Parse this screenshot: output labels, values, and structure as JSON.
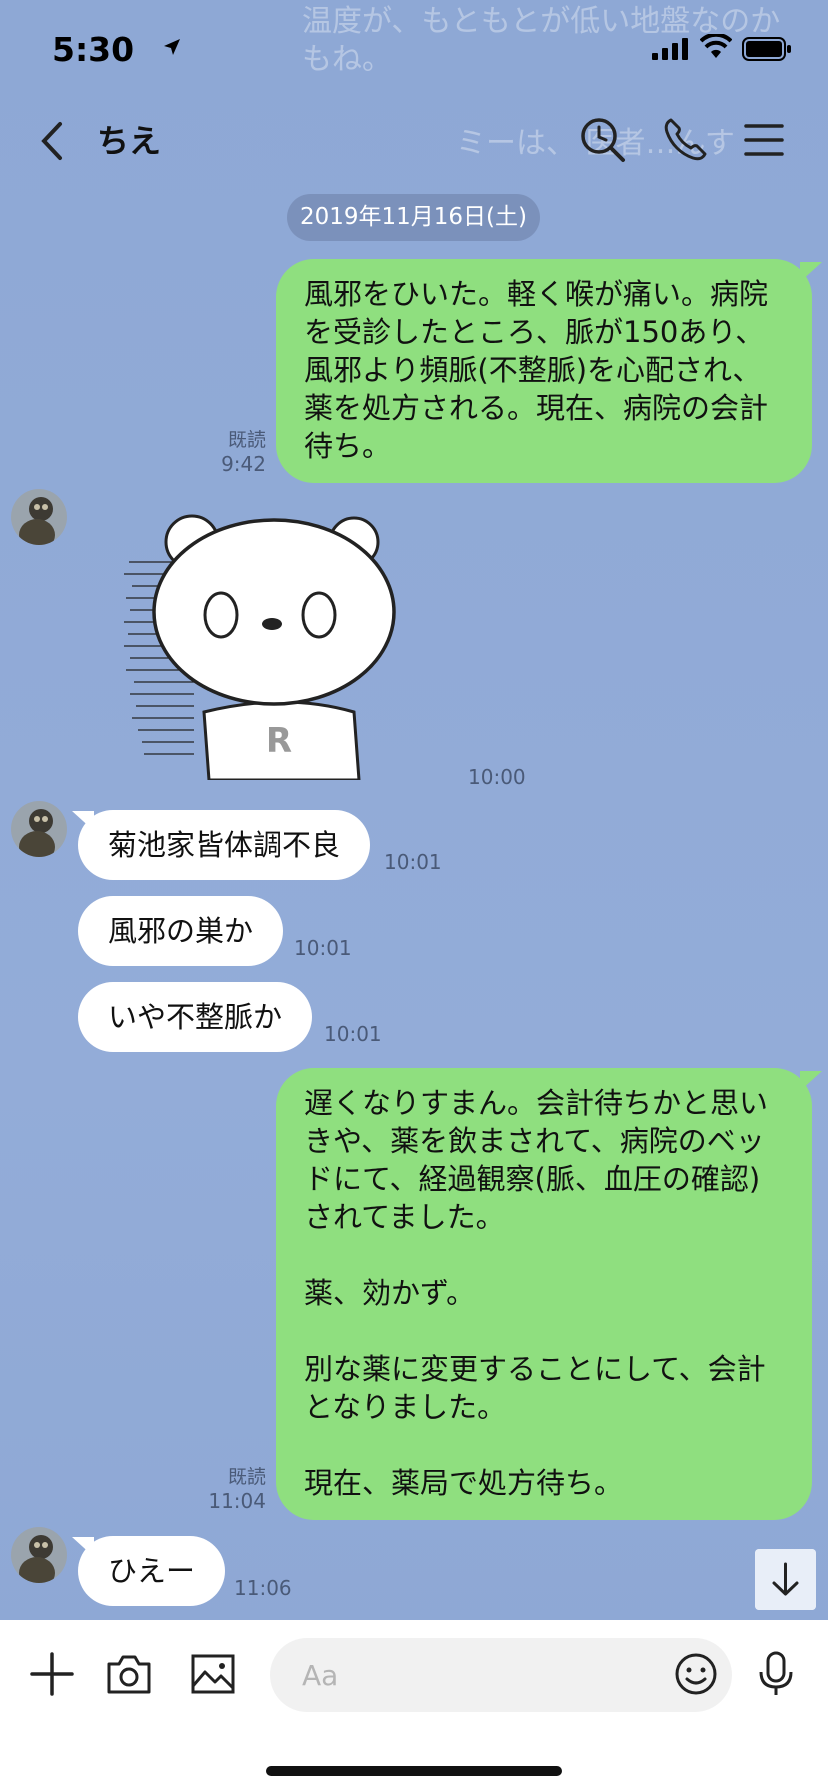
{
  "status_bar": {
    "time": "5:30"
  },
  "background_ghost": {
    "line1": "温度が、もともとが低い地盤なのか",
    "line2": "もね。",
    "line3": "ミーは、     医者…んす"
  },
  "header": {
    "chat_name": "ちえ",
    "icons": [
      "back-chevron-icon",
      "search-clock-icon",
      "phone-icon",
      "menu-icon"
    ]
  },
  "date_separator": "2019年11月16日(土)",
  "messages": [
    {
      "from": "me",
      "text": "風邪をひいた。軽く喉が痛い。病院\nを受診したところ、脈が150あり、\n風邪より頻脈(不整脈)を心配され、\n薬を処方される。現在、病院の会計\n待ち。",
      "read": "既読",
      "time": "9:42"
    },
    {
      "from": "them",
      "type": "sticker",
      "time": "10:00"
    },
    {
      "from": "them",
      "text": "菊池家皆体調不良",
      "time": "10:01"
    },
    {
      "from": "them",
      "text": "風邪の巣か",
      "time": "10:01"
    },
    {
      "from": "them",
      "text": "いや不整脈か",
      "time": "10:01"
    },
    {
      "from": "me",
      "text": "遅くなりすまん。会計待ちかと思い\nきや、薬を飲まされて、病院のベッ\nドにて、経過観察(脈、血圧の確認)\nされてました。\n\n薬、効かず。\n\n別な薬に変更することにして、会計\nとなりました。\n\n現在、薬局で処方待ち。",
      "read": "既読",
      "time": "11:04"
    },
    {
      "from": "them",
      "text": "ひえー",
      "time": "11:06"
    }
  ],
  "input_bar": {
    "placeholder": "Aa",
    "icons": [
      "plus-icon",
      "camera-icon",
      "image-icon",
      "emoji-icon",
      "microphone-icon"
    ]
  },
  "colors": {
    "background": "#8fa9d6",
    "my_bubble": "#8fdf7f",
    "their_bubble": "#ffffff",
    "date_pill": "#7b91bb"
  }
}
